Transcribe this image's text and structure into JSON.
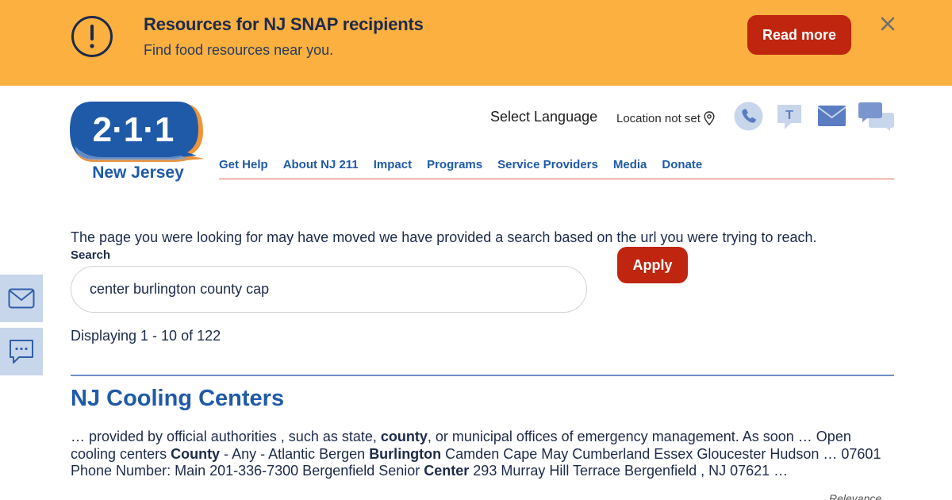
{
  "banner": {
    "title": "Resources for NJ SNAP recipients",
    "subtitle": "Find food resources near you.",
    "cta_label": "Read more",
    "icon": "alert-circle-icon",
    "background_color": "#fbb040",
    "cta_color": "#c0250f"
  },
  "logo": {
    "number": "2·1·1",
    "state": "New Jersey"
  },
  "header": {
    "language_label": "Select Language",
    "location_label": "Location not set",
    "icons": [
      "phone-icon",
      "text-icon",
      "mail-icon",
      "chat-icon"
    ]
  },
  "nav": {
    "items": [
      {
        "label": "Get Help"
      },
      {
        "label": "About NJ 211"
      },
      {
        "label": "Impact"
      },
      {
        "label": "Programs"
      },
      {
        "label": "Service Providers"
      },
      {
        "label": "Media"
      },
      {
        "label": "Donate"
      }
    ]
  },
  "main": {
    "notice": "The page you were looking for may have moved we have provided a search based on the url you were trying to reach.",
    "search_label": "Search",
    "search_value": "center burlington county cap",
    "apply_label": "Apply",
    "displaying": "Displaying 1 - 10 of 122",
    "relevance_label": "Relevance"
  },
  "results": [
    {
      "title": "NJ Cooling Centers",
      "snippet_parts": [
        {
          "text": "… provided by  official authorities , such as state, ",
          "bold": false
        },
        {
          "text": "county",
          "bold": true
        },
        {
          "text": ", or municipal offices of emergency management. As soon … Open cooling centers ",
          "bold": false
        },
        {
          "text": "County",
          "bold": true
        },
        {
          "text": " - Any - Atlantic Bergen ",
          "bold": false
        },
        {
          "text": "Burlington",
          "bold": true
        },
        {
          "text": " Camden Cape May Cumberland Essex Gloucester Hudson … 07601 Phone Number: Main 201-336-7300 Bergenfield Senior ",
          "bold": false
        },
        {
          "text": "Center",
          "bold": true
        },
        {
          "text": " 293 Murray Hill Terrace Bergenfield , NJ 07621 …",
          "bold": false
        }
      ]
    }
  ],
  "side_widgets": [
    "mail-icon",
    "chat-icon"
  ]
}
